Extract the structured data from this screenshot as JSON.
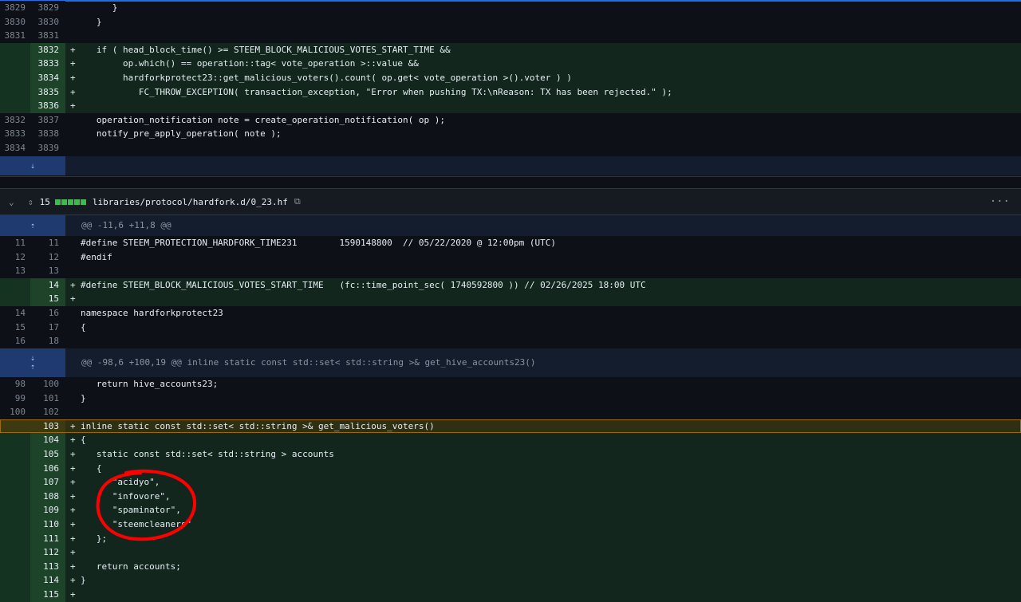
{
  "top_diff": {
    "rows": [
      {
        "type": "ctx",
        "old": "3829",
        "new": "3829",
        "mark": "",
        "code": "      }"
      },
      {
        "type": "ctx",
        "old": "3830",
        "new": "3830",
        "mark": "",
        "code": "   }"
      },
      {
        "type": "ctx",
        "old": "3831",
        "new": "3831",
        "mark": "",
        "code": ""
      },
      {
        "type": "add",
        "old": "",
        "new": "3832",
        "mark": "+",
        "code": "   if ( head_block_time() >= STEEM_BLOCK_MALICIOUS_VOTES_START_TIME &&"
      },
      {
        "type": "add",
        "old": "",
        "new": "3833",
        "mark": "+",
        "code": "        op.which() == operation::tag< vote_operation >::value &&"
      },
      {
        "type": "add",
        "old": "",
        "new": "3834",
        "mark": "+",
        "code": "        hardforkprotect23::get_malicious_voters().count( op.get< vote_operation >().voter ) )"
      },
      {
        "type": "add",
        "old": "",
        "new": "3835",
        "mark": "+",
        "code": "           FC_THROW_EXCEPTION( transaction_exception, \"Error when pushing TX:\\nReason: TX has been rejected.\" );"
      },
      {
        "type": "add",
        "old": "",
        "new": "3836",
        "mark": "+",
        "code": ""
      },
      {
        "type": "ctx",
        "old": "3832",
        "new": "3837",
        "mark": "",
        "code": "   operation_notification note = create_operation_notification( op );"
      },
      {
        "type": "ctx",
        "old": "3833",
        "new": "3838",
        "mark": "",
        "code": "   notify_pre_apply_operation( note );"
      },
      {
        "type": "ctx",
        "old": "3834",
        "new": "3839",
        "mark": "",
        "code": ""
      }
    ]
  },
  "file_header": {
    "changes": "15",
    "path": "libraries/protocol/hardfork.d/0_23.hf",
    "more": "···"
  },
  "hunk1": "@@ -11,6 +11,8 @@",
  "hunk2": "@@ -98,6 +100,19 @@ inline static const std::set< std::string >& get_hive_accounts23()",
  "bottom_a": [
    {
      "type": "ctx",
      "old": "11",
      "new": "11",
      "mark": "",
      "code": "#define STEEM_PROTECTION_HARDFORK_TIME231        1590148800  // 05/22/2020 @ 12:00pm (UTC)"
    },
    {
      "type": "ctx",
      "old": "12",
      "new": "12",
      "mark": "",
      "code": "#endif"
    },
    {
      "type": "ctx",
      "old": "13",
      "new": "13",
      "mark": "",
      "code": ""
    },
    {
      "type": "add",
      "old": "",
      "new": "14",
      "mark": "+",
      "code": "#define STEEM_BLOCK_MALICIOUS_VOTES_START_TIME   (fc::time_point_sec( 1740592800 )) // 02/26/2025 18:00 UTC"
    },
    {
      "type": "add",
      "old": "",
      "new": "15",
      "mark": "+",
      "code": ""
    },
    {
      "type": "ctx",
      "old": "14",
      "new": "16",
      "mark": "",
      "code": "namespace hardforkprotect23"
    },
    {
      "type": "ctx",
      "old": "15",
      "new": "17",
      "mark": "",
      "code": "{"
    },
    {
      "type": "ctx",
      "old": "16",
      "new": "18",
      "mark": "",
      "code": ""
    }
  ],
  "bottom_b": [
    {
      "type": "ctx",
      "old": "98",
      "new": "100",
      "mark": "",
      "code": "   return hive_accounts23;"
    },
    {
      "type": "ctx",
      "old": "99",
      "new": "101",
      "mark": "",
      "code": "}"
    },
    {
      "type": "ctx",
      "old": "100",
      "new": "102",
      "mark": "",
      "code": ""
    },
    {
      "type": "hl",
      "old": "",
      "new": "103",
      "mark": "+",
      "code": "inline static const std::set< std::string >& get_malicious_voters()"
    },
    {
      "type": "add",
      "old": "",
      "new": "104",
      "mark": "+",
      "code": "{"
    },
    {
      "type": "add",
      "old": "",
      "new": "105",
      "mark": "+",
      "code": "   static const std::set< std::string > accounts"
    },
    {
      "type": "add",
      "old": "",
      "new": "106",
      "mark": "+",
      "code": "   {"
    },
    {
      "type": "add",
      "old": "",
      "new": "107",
      "mark": "+",
      "code": "      \"acidyo\","
    },
    {
      "type": "add",
      "old": "",
      "new": "108",
      "mark": "+",
      "code": "      \"infovore\","
    },
    {
      "type": "add",
      "old": "",
      "new": "109",
      "mark": "+",
      "code": "      \"spaminator\","
    },
    {
      "type": "add",
      "old": "",
      "new": "110",
      "mark": "+",
      "code": "      \"steemcleaners\""
    },
    {
      "type": "add",
      "old": "",
      "new": "111",
      "mark": "+",
      "code": "   };"
    },
    {
      "type": "add",
      "old": "",
      "new": "112",
      "mark": "+",
      "code": ""
    },
    {
      "type": "add",
      "old": "",
      "new": "113",
      "mark": "+",
      "code": "   return accounts;"
    },
    {
      "type": "add",
      "old": "",
      "new": "114",
      "mark": "+",
      "code": "}"
    },
    {
      "type": "add",
      "old": "",
      "new": "115",
      "mark": "+",
      "code": ""
    }
  ],
  "colors": {
    "annotation": "#ff0000",
    "additions": "#3fb950"
  },
  "icons": [
    "chevron-down-icon",
    "unfold-icon",
    "copy-icon",
    "kebab-icon",
    "expand-down-icon",
    "expand-up-icon"
  ]
}
